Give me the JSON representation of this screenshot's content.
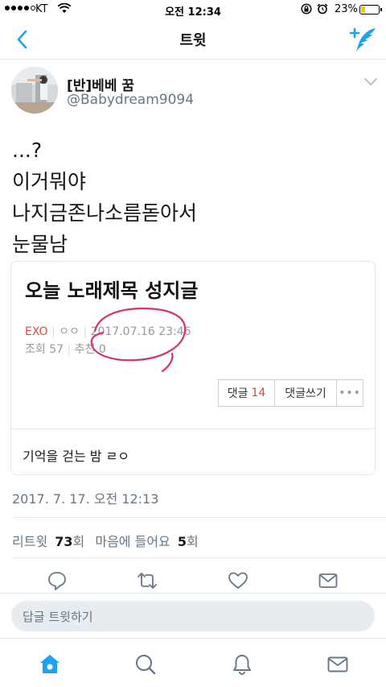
{
  "status_bar": {
    "carrier": "KT",
    "time": "오전 12:34",
    "battery": "23%",
    "battery_level": 0.23
  },
  "nav": {
    "title": "트윗"
  },
  "tweet": {
    "display_name": "[반]베베 꿈",
    "handle": "@Babydream9094",
    "text_lines": [
      "...?",
      "이거뭐야",
      "나지금존나소름돋아서",
      "눈물남"
    ],
    "card": {
      "headline": "오늘 노래제목 성지글",
      "category": "EXO",
      "author": "ㅇㅇ",
      "post_time": "2017.07.16 23:46",
      "views": "조회 57",
      "recommends": "추천 0",
      "comments_label": "댓글",
      "comments_count": "14",
      "write_comment_label": "댓글쓰기",
      "more_label": "•••",
      "caption": "기억을 걷는 밤 ㄹㅇ"
    },
    "timestamp": "2017. 7. 17. 오전 12:13",
    "stats": {
      "retweets_label": "리트윗",
      "retweets_count": "73",
      "retweets_unit": "회",
      "likes_label": "마음에 들어요",
      "likes_count": "5",
      "likes_unit": "회"
    }
  },
  "reply": {
    "placeholder": "답글 트윗하기"
  },
  "colors": {
    "accent": "#1da1f2",
    "muted": "#657786",
    "annotation": "#d6336c"
  },
  "icons": {
    "back": "chevron-left-icon",
    "compose": "compose-tweet-icon",
    "reply": "reply-icon",
    "retweet": "retweet-icon",
    "like": "heart-icon",
    "dm": "mail-icon",
    "home": "home-icon",
    "search": "search-icon",
    "notifications": "bell-icon",
    "messages": "mail-icon"
  }
}
